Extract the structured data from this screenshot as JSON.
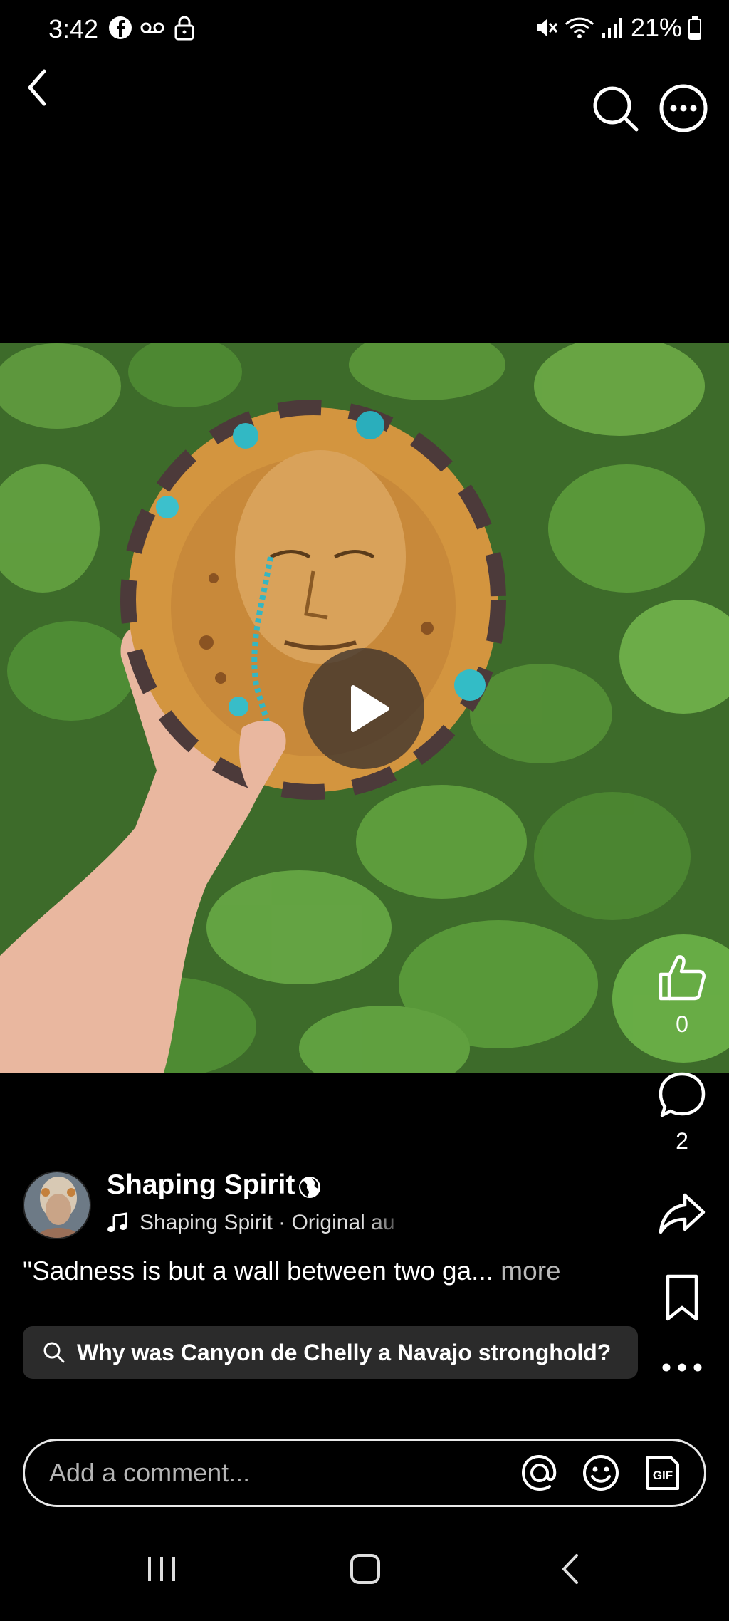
{
  "status_bar": {
    "time": "3:42",
    "battery": "21%",
    "icons": [
      "facebook-icon",
      "voicemail-icon",
      "lock-icon",
      "mute-icon",
      "wifi-icon",
      "signal-icon",
      "battery-icon"
    ]
  },
  "top_bar": {
    "icons": [
      "back-icon",
      "search-icon",
      "more-icon"
    ]
  },
  "rail": {
    "like_count": "0",
    "comment_count": "2"
  },
  "post": {
    "author": "Shaping Spirit",
    "audio": "Shaping Spirit · Original au",
    "caption": "\"Sadness is but a wall between two ga...",
    "caption_more": "more",
    "suggestion": "Why was Canyon de Chelly a Navajo stronghold?"
  },
  "comment": {
    "placeholder": "Add a comment..."
  },
  "colors": {
    "background": "#000000",
    "chip": "#2b2b2b",
    "text": "#ffffff"
  }
}
